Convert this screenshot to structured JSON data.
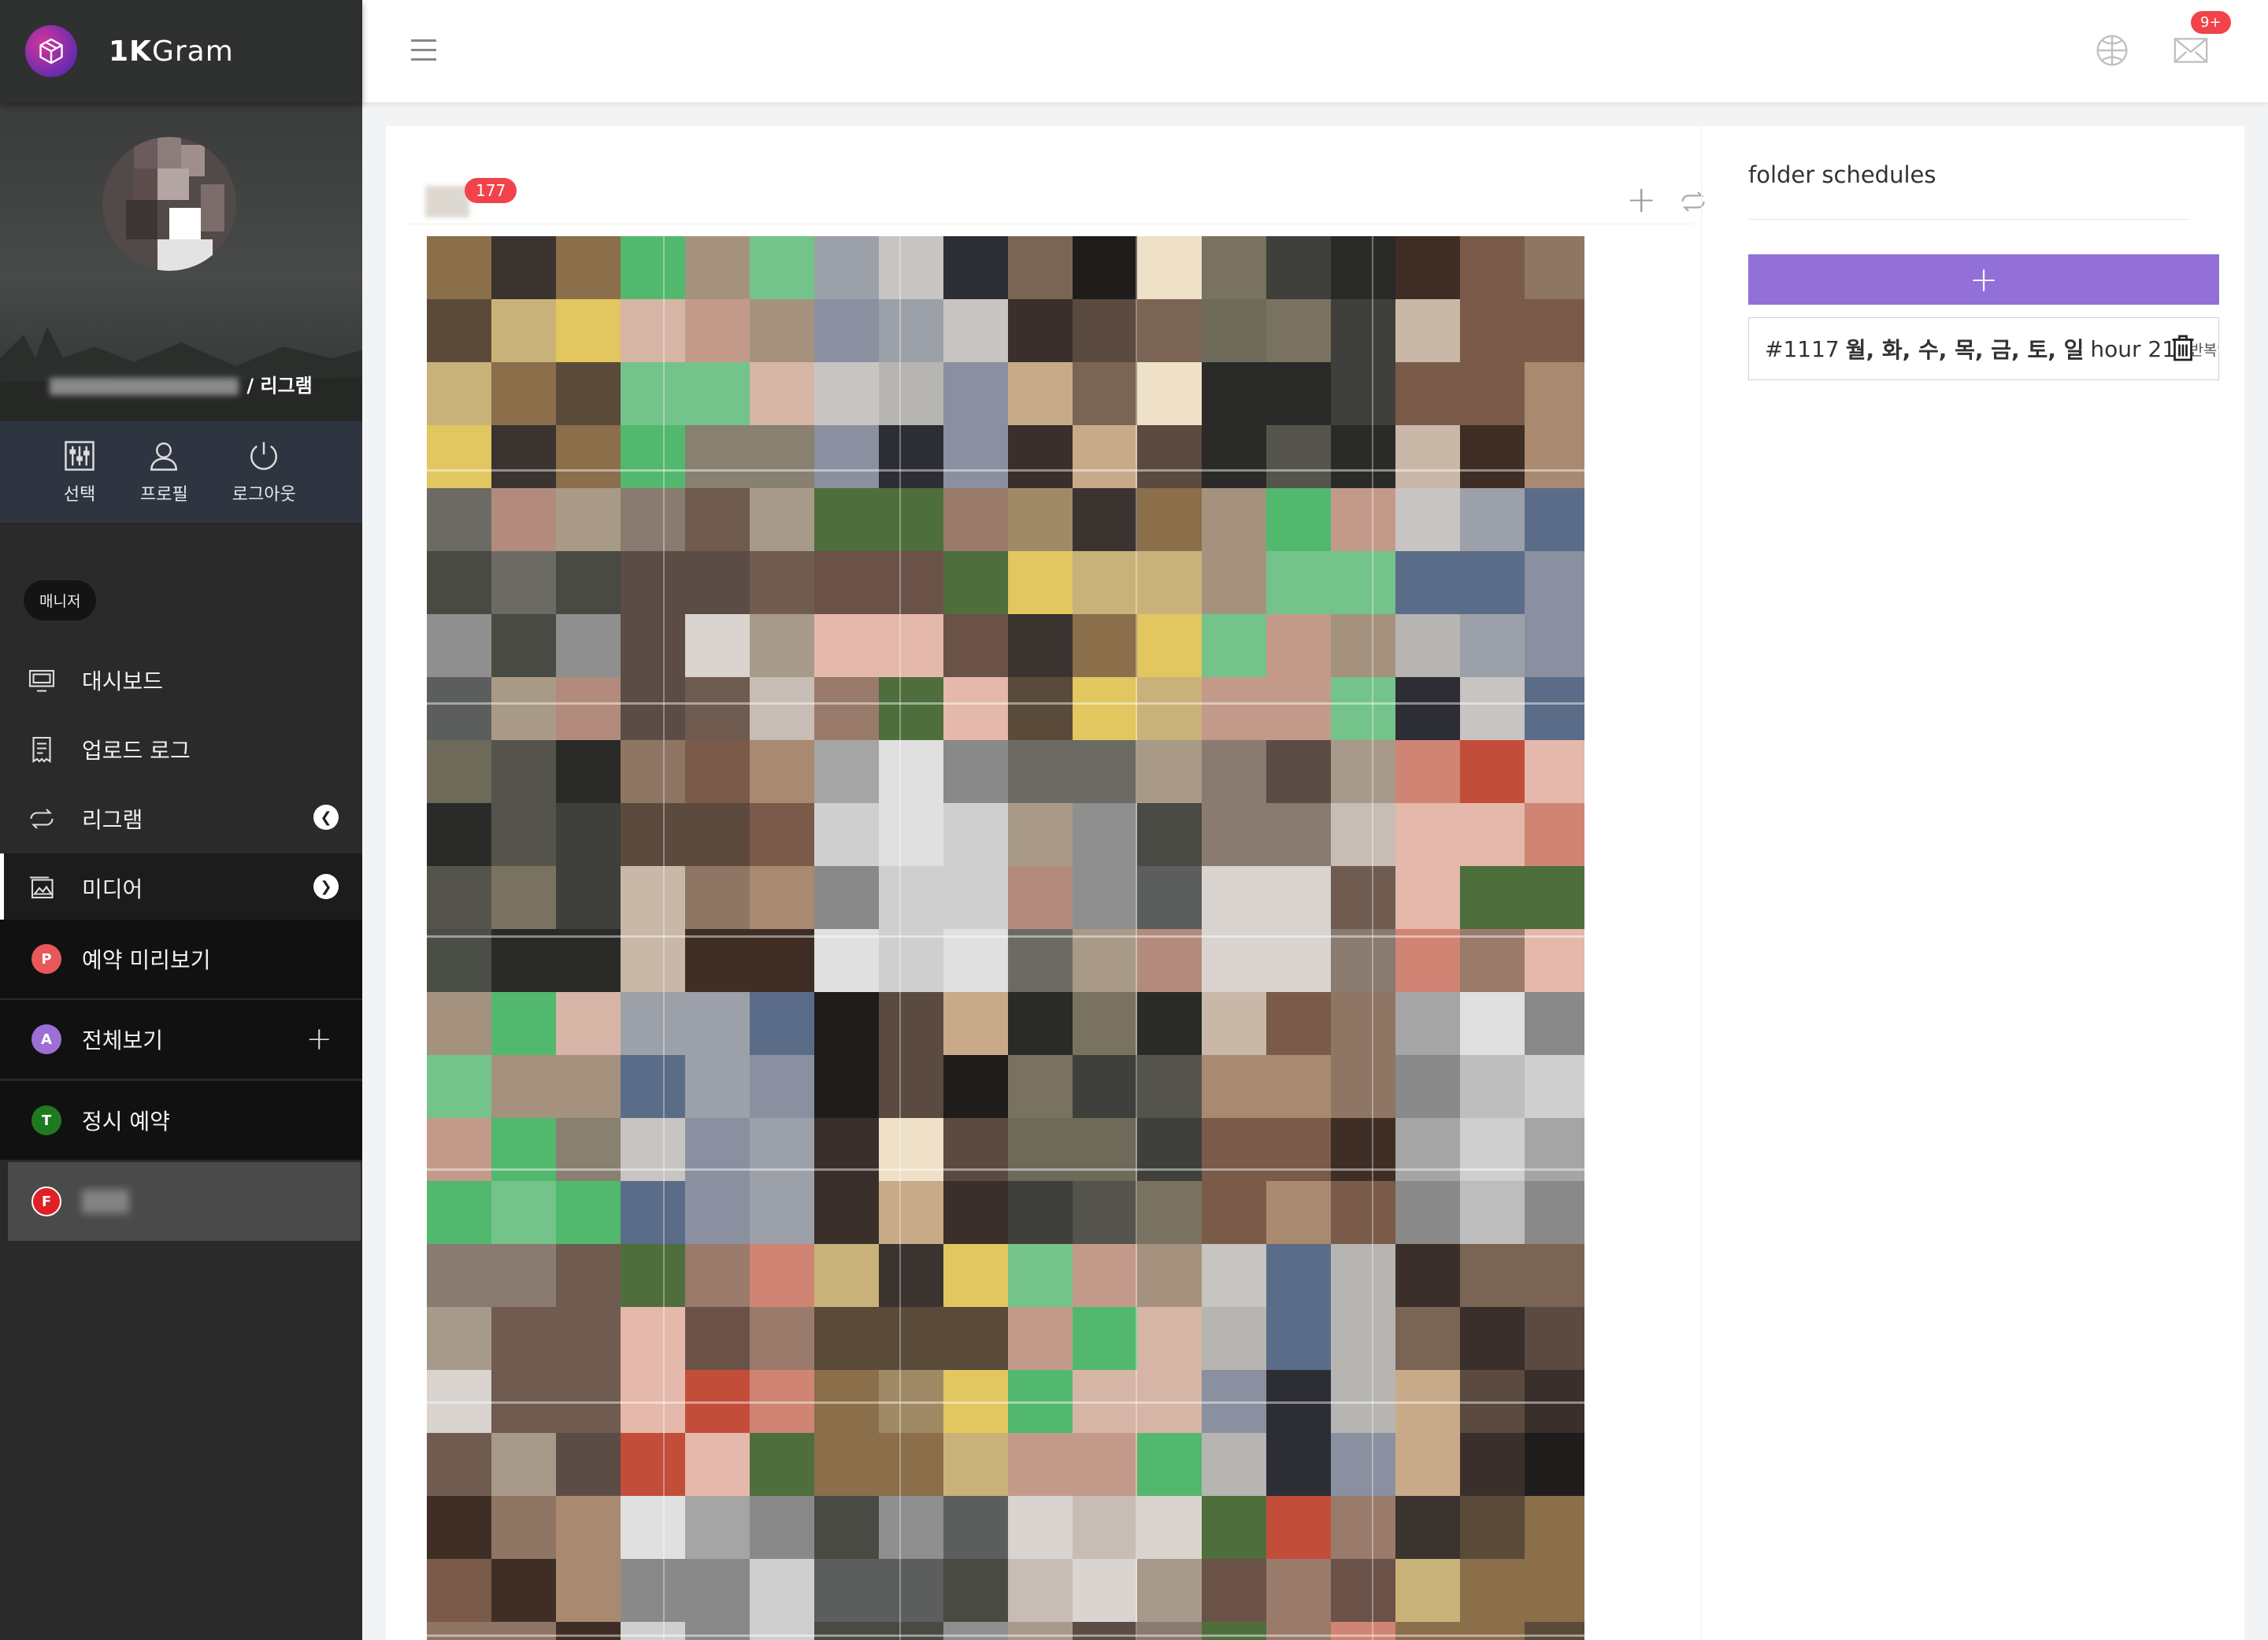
{
  "brand": {
    "name_bold": "1K",
    "name_rest": "Gram"
  },
  "profile": {
    "suffix": "/ 리그램"
  },
  "quick_actions": [
    {
      "label": "선택",
      "icon": "sliders-icon"
    },
    {
      "label": "프로필",
      "icon": "user-icon"
    },
    {
      "label": "로그아웃",
      "icon": "power-icon"
    }
  ],
  "section_tag": "매니저",
  "nav": [
    {
      "label": "대시보드",
      "icon": "monitor-icon"
    },
    {
      "label": "업로드 로그",
      "icon": "receipt-icon"
    },
    {
      "label": "리그램",
      "icon": "repeat-icon",
      "chevron": "<"
    },
    {
      "label": "미디어",
      "icon": "image-icon",
      "chevron": "v",
      "active": true
    }
  ],
  "media_sub": [
    {
      "badge": "P",
      "color": "#e8585a",
      "label": "예약 미리보기"
    },
    {
      "badge": "A",
      "color": "#9b6fd6",
      "label": "전체보기",
      "has_plus": true
    },
    {
      "badge": "T",
      "color": "#1f7a1f",
      "label": "정시 예약"
    },
    {
      "badge": "F",
      "color": "#e11f26",
      "label": "",
      "selected": true
    }
  ],
  "topbar": {
    "notification_count": "9+"
  },
  "media": {
    "count": "177"
  },
  "schedules": {
    "title": "folder schedules",
    "add_label": "+",
    "items": [
      {
        "id": "#1117",
        "days": "월, 화, 수, 목, 금, 토, 일",
        "hour": "hour 21",
        "repeat": "(반복안함)"
      }
    ]
  },
  "colors": {
    "accent": "#9370d8",
    "badge_red": "#f2434b",
    "sidebar": "#2a2a2a"
  }
}
